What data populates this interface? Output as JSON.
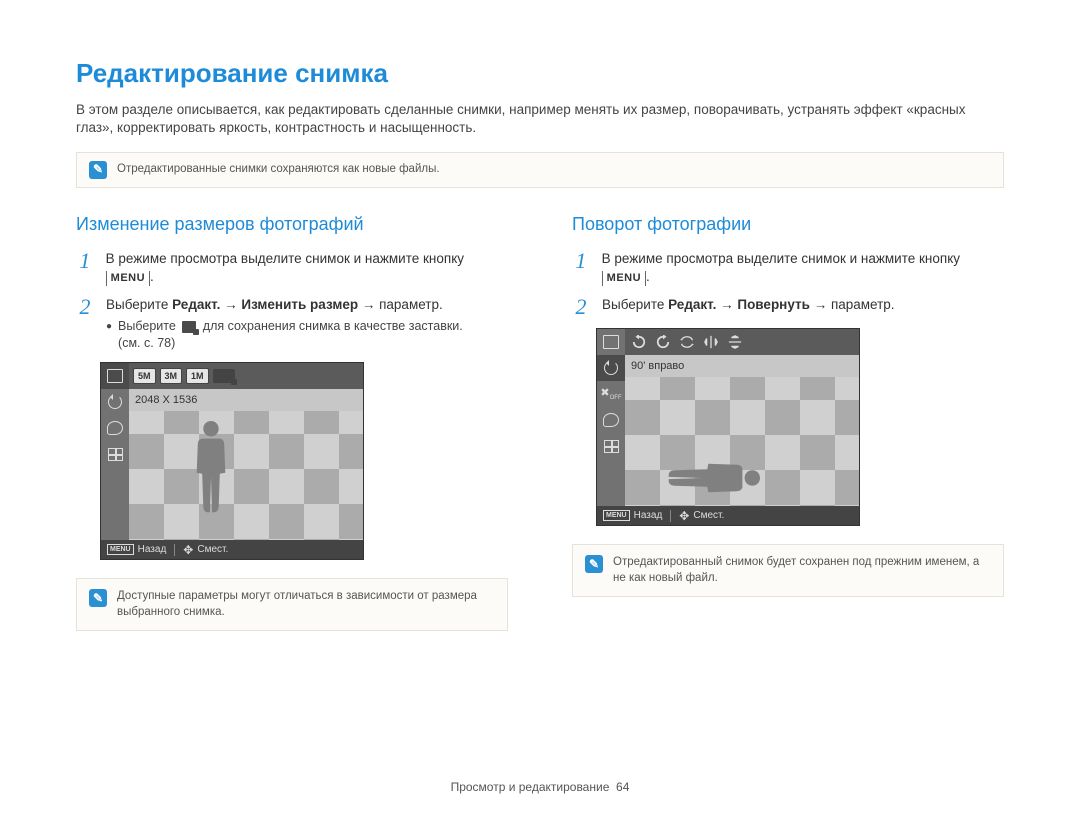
{
  "page": {
    "title": "Редактирование снимка",
    "lead": "В этом разделе описывается, как редактировать сделанные снимки, например менять их размер, поворачивать, устранять эффект «красных глаз», корректировать яркость, контрастность и насыщенность."
  },
  "notes": {
    "top": "Отредактированные снимки сохраняются как новые файлы.",
    "left": "Доступные параметры могут отличаться в зависимости от размера выбранного снимка.",
    "right": "Отредактированный снимок будет сохранен под прежним именем, а не как новый файл."
  },
  "common": {
    "menu_label": "MENU",
    "arrow": "→",
    "step1": "В режиме просмотра выделите снимок и нажмите кнопку",
    "step1_suffix": ".",
    "select_prefix": "Выберите ",
    "edit_label": "Редакт.",
    "param_suffix": " параметр."
  },
  "left": {
    "heading": "Изменение размеров фотографий",
    "resize_label": "Изменить размер",
    "bullet_prefix": "Выберите ",
    "bullet_suffix": " для сохранения снимка в качестве заставки.",
    "see_page": "(см. с. 78)",
    "lcd": {
      "size_chips": [
        "5M",
        "3M",
        "1M"
      ],
      "value": "2048 X 1536"
    }
  },
  "right": {
    "heading": "Поворот фотографии",
    "rotate_label": "Повернуть",
    "lcd": {
      "value": "90' вправо"
    }
  },
  "status_bar": {
    "back": "Назад",
    "move": "Смест.",
    "menu_badge": "MENU"
  },
  "footer": {
    "section": "Просмотр и редактирование",
    "page_num": "64"
  }
}
